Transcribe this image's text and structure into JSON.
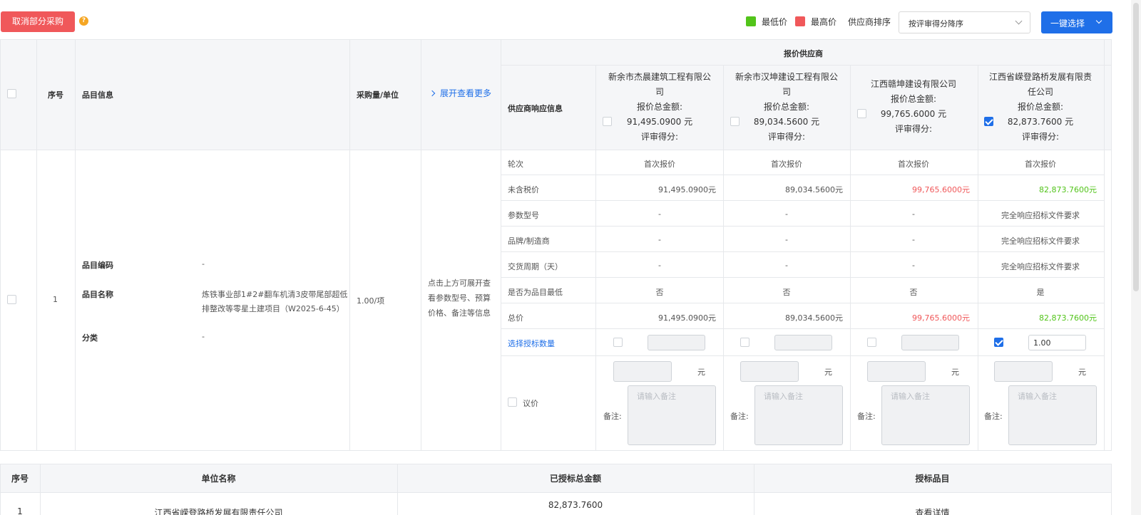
{
  "toolbar": {
    "cancel_label": "取消部分采购",
    "help": "?",
    "legend_low": "最低价",
    "legend_high": "最高价",
    "legend_low_color": "#52c41a",
    "legend_high_color": "#f0585a",
    "sort_label": "供应商排序",
    "sort_value": "按评审得分降序",
    "select_all_label": "一键选择"
  },
  "table": {
    "headers": {
      "index": "序号",
      "item_info": "品目信息",
      "qty_unit": "采购量/单位",
      "expand": "展开查看更多",
      "quote_suppliers": "报价供应商",
      "supplier_response": "供应商响应信息"
    },
    "suppliers": [
      {
        "name_line1": "新余市杰晨建筑工程有限公",
        "name_line2": "司",
        "total_label": "报价总金额:",
        "total": "91,495.0900 元",
        "score_label": "评审得分:",
        "checked": false
      },
      {
        "name_line1": "新余市汉坤建设工程有限公",
        "name_line2": "司",
        "total_label": "报价总金额:",
        "total": "89,034.5600 元",
        "score_label": "评审得分:",
        "checked": false
      },
      {
        "name_line1": "江西赣坤建设有限公司",
        "name_line2": "",
        "total_label": "报价总金额:",
        "total": "99,765.6000 元",
        "score_label": "评审得分:",
        "checked": false
      },
      {
        "name_line1": "江西省嵘登路桥发展有限责",
        "name_line2": "任公司",
        "total_label": "报价总金额:",
        "total": "82,873.7600 元",
        "score_label": "评审得分:",
        "checked": true
      }
    ],
    "row": {
      "index": "1",
      "code_label": "品目编码",
      "code_value": "-",
      "name_label": "品目名称",
      "name_line1": "炼铁事业部1#2#翻车机清3皮带尾部超低",
      "name_line2": "排整改等零星土建项目（W2025-6-45）",
      "category_label": "分类",
      "category_value": "-",
      "qty": "1.00/项",
      "hint_line1": "点击上方可展开查",
      "hint_line2": "看参数型号、预算",
      "hint_line3": "价格、备注等信息"
    },
    "response_rows": {
      "round": {
        "label": "轮次",
        "values": [
          "首次报价",
          "首次报价",
          "首次报价",
          "首次报价"
        ]
      },
      "pretax": {
        "label": "未含税价",
        "values": [
          "91,495.0900元",
          "89,034.5600元",
          "99,765.6000元",
          "82,873.7600元"
        ]
      },
      "model": {
        "label": "参数型号",
        "values": [
          "-",
          "-",
          "-",
          "完全响应招标文件要求"
        ]
      },
      "brand": {
        "label": "品牌/制造商",
        "values": [
          "-",
          "-",
          "-",
          "完全响应招标文件要求"
        ]
      },
      "delivery": {
        "label": "交货周期（天）",
        "values": [
          "-",
          "-",
          "-",
          "完全响应招标文件要求"
        ]
      },
      "lowest": {
        "label": "是否为品目最低",
        "values": [
          "否",
          "否",
          "否",
          "是"
        ]
      },
      "total": {
        "label": "总价",
        "values": [
          "91,495.0900元",
          "89,034.5600元",
          "99,765.6000元",
          "82,873.7600元"
        ]
      },
      "award_qty": {
        "label": "选择授标数量",
        "values": [
          "",
          "",
          "",
          "1.00"
        ]
      },
      "negotiate": {
        "label": "议价",
        "unit": "元",
        "remark_label": "备注:",
        "remark_placeholder": "请输入备注"
      }
    }
  },
  "summary": {
    "headers": {
      "index": "序号",
      "unit_name": "单位名称",
      "awarded_total": "已授标总金额",
      "awarded_items": "授标品目"
    },
    "rows": [
      {
        "index": "1",
        "unit_name": "江西省嵘登路桥发展有限责任公司",
        "awarded_total": "82,873.7600",
        "awarded_items": "查看详情"
      }
    ]
  }
}
